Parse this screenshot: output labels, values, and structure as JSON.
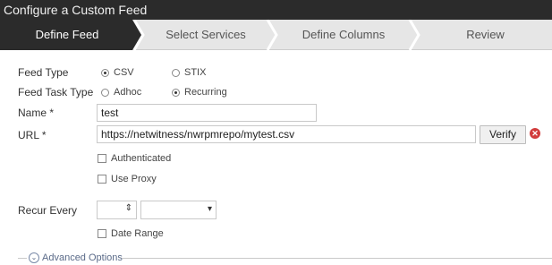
{
  "window": {
    "title": "Configure a Custom Feed"
  },
  "wizard": {
    "steps": [
      {
        "label": "Define Feed",
        "active": true
      },
      {
        "label": "Select Services",
        "active": false
      },
      {
        "label": "Define Columns",
        "active": false
      },
      {
        "label": "Review",
        "active": false
      }
    ]
  },
  "form": {
    "feed_type": {
      "label": "Feed Type",
      "options": [
        {
          "label": "CSV",
          "selected": true
        },
        {
          "label": "STIX",
          "selected": false
        }
      ]
    },
    "feed_task_type": {
      "label": "Feed Task Type",
      "options": [
        {
          "label": "Adhoc",
          "selected": false
        },
        {
          "label": "Recurring",
          "selected": true
        }
      ]
    },
    "name": {
      "label": "Name *",
      "value": "test"
    },
    "url": {
      "label": "URL *",
      "value": "https://netwitness/nwrpmrepo/mytest.csv",
      "verify_label": "Verify",
      "error_icon": "error-circle-icon"
    },
    "authenticated": {
      "label": "Authenticated",
      "checked": false
    },
    "use_proxy": {
      "label": "Use Proxy",
      "checked": false
    },
    "recur_every": {
      "label": "Recur Every",
      "value": "",
      "unit": ""
    },
    "date_range": {
      "label": "Date Range",
      "checked": false
    },
    "advanced_options": {
      "label": "Advanced Options"
    }
  },
  "colors": {
    "active_step": "#2b2b2b",
    "inactive_step": "#e6e6e6",
    "error": "#d23c3c"
  }
}
